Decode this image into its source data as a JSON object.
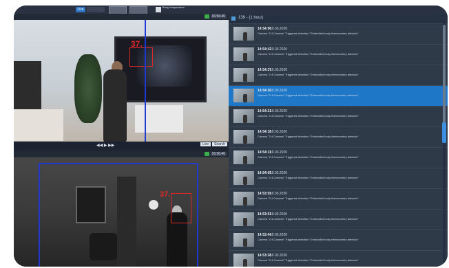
{
  "toolbar": {
    "live_label": "Live",
    "archive_label": "",
    "user_label": "Body temperature"
  },
  "cameras": {
    "top": {
      "title": "",
      "time": "16:56:40"
    },
    "bottom": {
      "title": "",
      "time": "16:56:40"
    }
  },
  "timeline": {
    "live_button": "Live",
    "search_button": "Search"
  },
  "overlays": {
    "temp_top": "37.",
    "temp_bottom": "37."
  },
  "events": {
    "title": "139 - (1 hour)",
    "rows": [
      {
        "time": "14:54:56",
        "date": "10.03.2020",
        "desc": "Camera \"2.4 Camera\" Triggered detection \"Embedded body thermometry detector\"",
        "selected": false
      },
      {
        "time": "14:54:42",
        "date": "10.03.2020",
        "desc": "Camera \"2.4 Camera\" Triggered detection \"Embedded body thermometry detector\"",
        "selected": false
      },
      {
        "time": "14:54:37",
        "date": "10.03.2020",
        "desc": "Camera \"2.4 Camera\" Triggered detection \"Embedded body thermometry detector\"",
        "selected": false
      },
      {
        "time": "14:54:30",
        "date": "10.03.2020",
        "desc": "Camera \"2.4 Camera\" Triggered detection \"Embedded body thermometry detector\"",
        "selected": true
      },
      {
        "time": "14:54:21",
        "date": "10.03.2020",
        "desc": "Camera \"2.4 Camera\" Triggered detection \"Embedded body thermometry detector\"",
        "selected": false
      },
      {
        "time": "14:54:18",
        "date": "10.03.2020",
        "desc": "Camera \"2.4 Camera\" Triggered detection \"Embedded body thermometry detector\"",
        "selected": false
      },
      {
        "time": "14:54:11",
        "date": "10.03.2020",
        "desc": "Camera \"2.4 Camera\" Triggered detection \"Embedded body thermometry detector\"",
        "selected": false
      },
      {
        "time": "14:54:05",
        "date": "10.03.2020",
        "desc": "Camera \"2.4 Camera\" Triggered detection \"Embedded body thermometry detector\"",
        "selected": false
      },
      {
        "time": "14:53:59",
        "date": "10.03.2020",
        "desc": "Camera \"2.4 Camera\" Triggered detection \"Embedded body thermometry detector\"",
        "selected": false
      },
      {
        "time": "14:53:51",
        "date": "10.03.2020",
        "desc": "Camera \"2.4 Camera\" Triggered detection \"Embedded body thermometry detector\"",
        "selected": false
      },
      {
        "time": "14:53:44",
        "date": "10.03.2020",
        "desc": "Camera \"2.4 Camera\" Triggered detection \"Embedded body thermometry detector\"",
        "selected": false
      },
      {
        "time": "14:53:38",
        "date": "10.03.2020",
        "desc": "Camera \"2.4 Camera\" Triggered detection \"Embedded body thermometry detector\"",
        "selected": false
      }
    ]
  },
  "colors": {
    "accent": "#1f77c8",
    "alert": "#e02828",
    "line": "#1f39d6",
    "rec": "#3bb04a"
  }
}
